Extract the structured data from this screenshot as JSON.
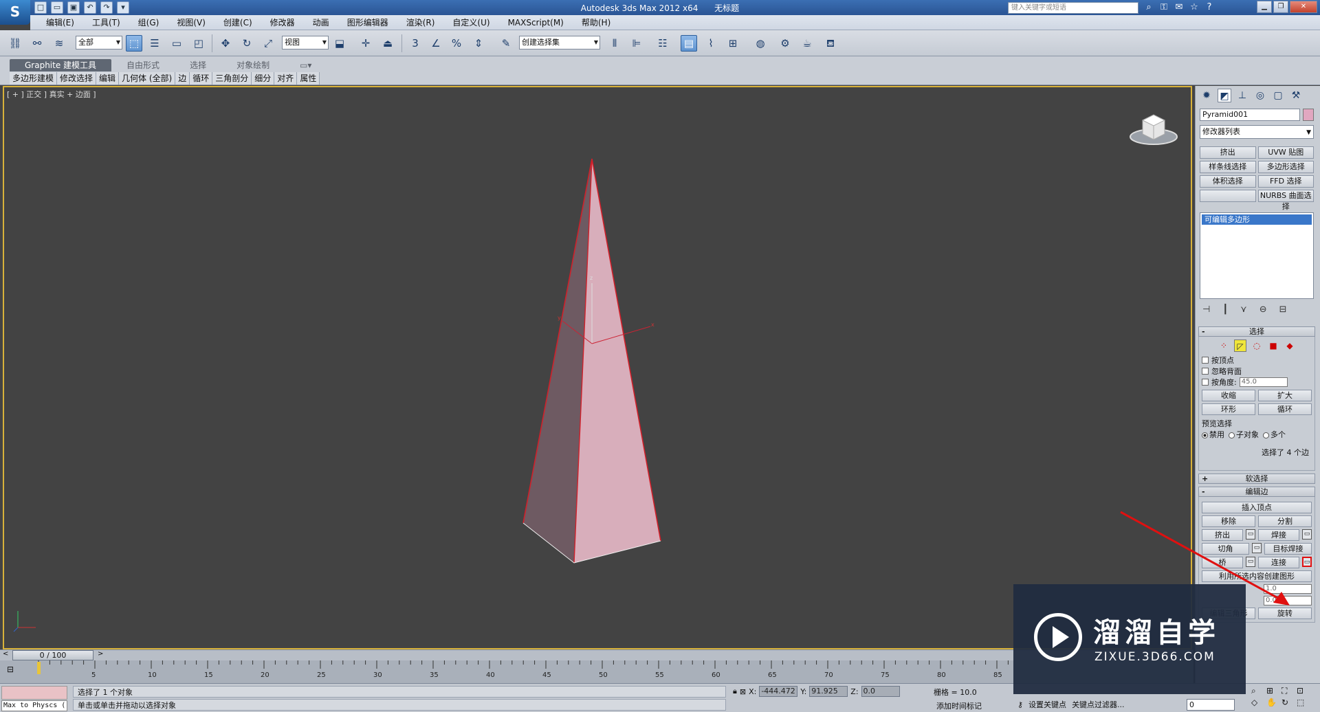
{
  "titlebar": {
    "app_title": "Autodesk 3ds Max  2012 x64",
    "doc_title": "无标题",
    "search_placeholder": "键入关键字或短语",
    "logo": "S"
  },
  "menu": [
    "编辑(E)",
    "工具(T)",
    "组(G)",
    "视图(V)",
    "创建(C)",
    "修改器",
    "动画",
    "图形编辑器",
    "渲染(R)",
    "自定义(U)",
    "MAXScript(M)",
    "帮助(H)"
  ],
  "toolbar": {
    "filter_value": "全部",
    "refcoord_value": "视图",
    "selset_value": "创建选择集",
    "snap_3": "3",
    "snap_angle": "∠",
    "snap_percent": "%"
  },
  "ribbon": {
    "tabs": [
      "Graphite 建模工具",
      "自由形式",
      "选择",
      "对象绘制"
    ],
    "panels": [
      "多边形建模",
      "修改选择",
      "编辑",
      "几何体 (全部)",
      "边",
      "循环",
      "三角剖分",
      "细分",
      "对齐",
      "属性"
    ]
  },
  "viewport": {
    "label": "[ + ] 正交 ] 真实 + 边面 ]",
    "object_color": "#d8aebb",
    "edge_color": "#d0202a"
  },
  "command_panel": {
    "object_name": "Pyramid001",
    "modifier_list": "修改器列表",
    "mod_buttons": [
      "挤出",
      "UVW 贴图",
      "样条线选择",
      "多边形选择",
      "体积选择",
      "FFD 选择",
      "",
      "NURBS 曲面选择"
    ],
    "stack_item": "可编辑多边形",
    "selection": {
      "title": "选择",
      "by_vertex": "按顶点",
      "ignore_back": "忽略背面",
      "by_angle": "按角度:",
      "angle_value": "45.0",
      "shrink": "收缩",
      "grow": "扩大",
      "ring": "环形",
      "loop": "循环",
      "preview_label": "预览选择",
      "preview_off": "禁用",
      "preview_sub": "子对象",
      "preview_multi": "多个",
      "status": "选择了 4 个边"
    },
    "soft_selection": "软选择",
    "edit_edges": {
      "title": "编辑边",
      "insert_vertex": "插入顶点",
      "remove": "移除",
      "split": "分割",
      "extrude": "挤出",
      "weld": "焊接",
      "chamfer": "切角",
      "target_weld": "目标焊接",
      "bridge": "桥",
      "connect": "连接",
      "create_shape": "利用所选内容创建图形",
      "weight_value": "1.0",
      "crease_value": "0.0",
      "edit_tri": "编辑三角形",
      "turn": "旋转"
    }
  },
  "timeline": {
    "slider_label": "0 / 100",
    "ticks": [
      "5",
      "10",
      "15",
      "20",
      "25",
      "30",
      "35",
      "40",
      "45",
      "50",
      "55",
      "60",
      "65",
      "70",
      "75",
      "80",
      "85"
    ]
  },
  "status": {
    "physx": "Max to Physcs (",
    "line1": "选择了 1 个对象",
    "line2": "单击或单击并拖动以选择对象",
    "x_label": "X:",
    "x_value": "-444.472",
    "y_label": "Y:",
    "y_value": "91.925",
    "z_label": "Z:",
    "z_value": "0.0",
    "grid": "栅格 = 10.0",
    "add_time_tag": "添加时间标记",
    "set_key": "设置关键点",
    "key_filters": "关键点过滤器...",
    "frame_value": "0"
  },
  "watermark": {
    "title": "溜溜自学",
    "url": "ZIXUE.3D66.COM"
  },
  "icons": {
    "close": "close-icon",
    "minimize": "minimize-icon",
    "maximize": "maximize-icon",
    "help": "help-icon",
    "arrow_color": "#e01010"
  }
}
